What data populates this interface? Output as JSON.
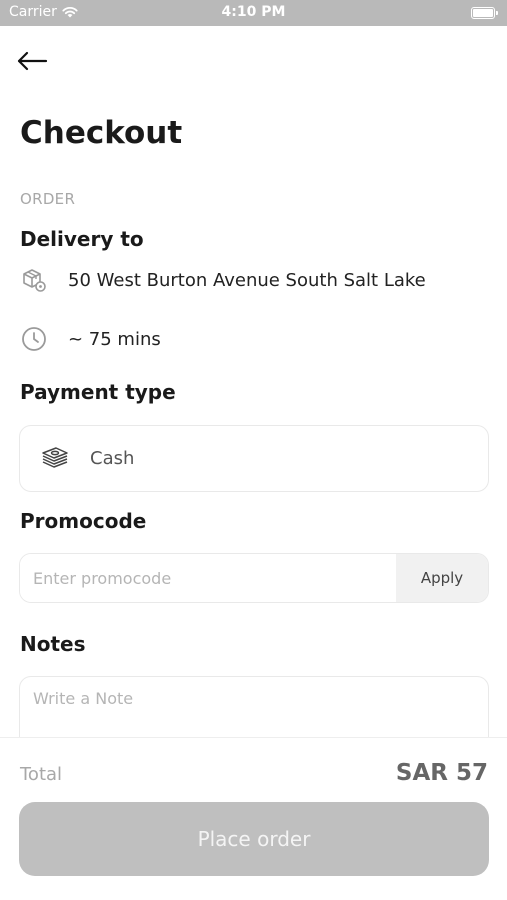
{
  "status_bar": {
    "carrier": "Carrier",
    "time": "4:10 PM"
  },
  "header": {
    "title": "Checkout"
  },
  "order": {
    "caption": "ORDER",
    "delivery_heading": "Delivery to",
    "address": "50 West Burton Avenue South Salt Lake",
    "eta": "~ 75 mins"
  },
  "payment": {
    "heading": "Payment type",
    "method": "Cash"
  },
  "promo": {
    "heading": "Promocode",
    "placeholder": "Enter promocode",
    "value": "",
    "apply_label": "Apply"
  },
  "notes": {
    "heading": "Notes",
    "placeholder": "Write a Note"
  },
  "footer": {
    "total_label": "Total",
    "total_value": "SAR 57",
    "place_order_label": "Place order"
  }
}
